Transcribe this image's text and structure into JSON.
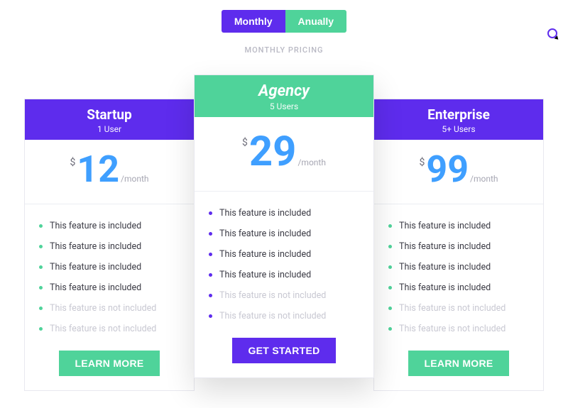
{
  "toggle": {
    "monthly": "Monthly",
    "annually": "Anually"
  },
  "subtitle": "MONTHLY PRICING",
  "price": {
    "currency": "$",
    "period": "/month"
  },
  "plans": [
    {
      "name": "Startup",
      "users": "1 User",
      "price": "12",
      "cta": "LEARN MORE",
      "features": [
        {
          "text": "This feature is included",
          "included": true
        },
        {
          "text": "This feature is included",
          "included": true
        },
        {
          "text": "This feature is included",
          "included": true
        },
        {
          "text": "This feature is included",
          "included": true
        },
        {
          "text": "This feature is not included",
          "included": false
        },
        {
          "text": "This feature is not included",
          "included": false
        }
      ]
    },
    {
      "name": "Agency",
      "users": "5 Users",
      "price": "29",
      "cta": "GET STARTED",
      "features": [
        {
          "text": "This feature is included",
          "included": true
        },
        {
          "text": "This feature is included",
          "included": true
        },
        {
          "text": "This feature is included",
          "included": true
        },
        {
          "text": "This feature is included",
          "included": true
        },
        {
          "text": "This feature is not included",
          "included": false
        },
        {
          "text": "This feature is not included",
          "included": false
        }
      ]
    },
    {
      "name": "Enterprise",
      "users": "5+ Users",
      "price": "99",
      "cta": "LEARN MORE",
      "features": [
        {
          "text": "This feature is included",
          "included": true
        },
        {
          "text": "This feature is included",
          "included": true
        },
        {
          "text": "This feature is included",
          "included": true
        },
        {
          "text": "This feature is included",
          "included": true
        },
        {
          "text": "This feature is not included",
          "included": false
        },
        {
          "text": "This feature is not included",
          "included": false
        }
      ]
    }
  ]
}
